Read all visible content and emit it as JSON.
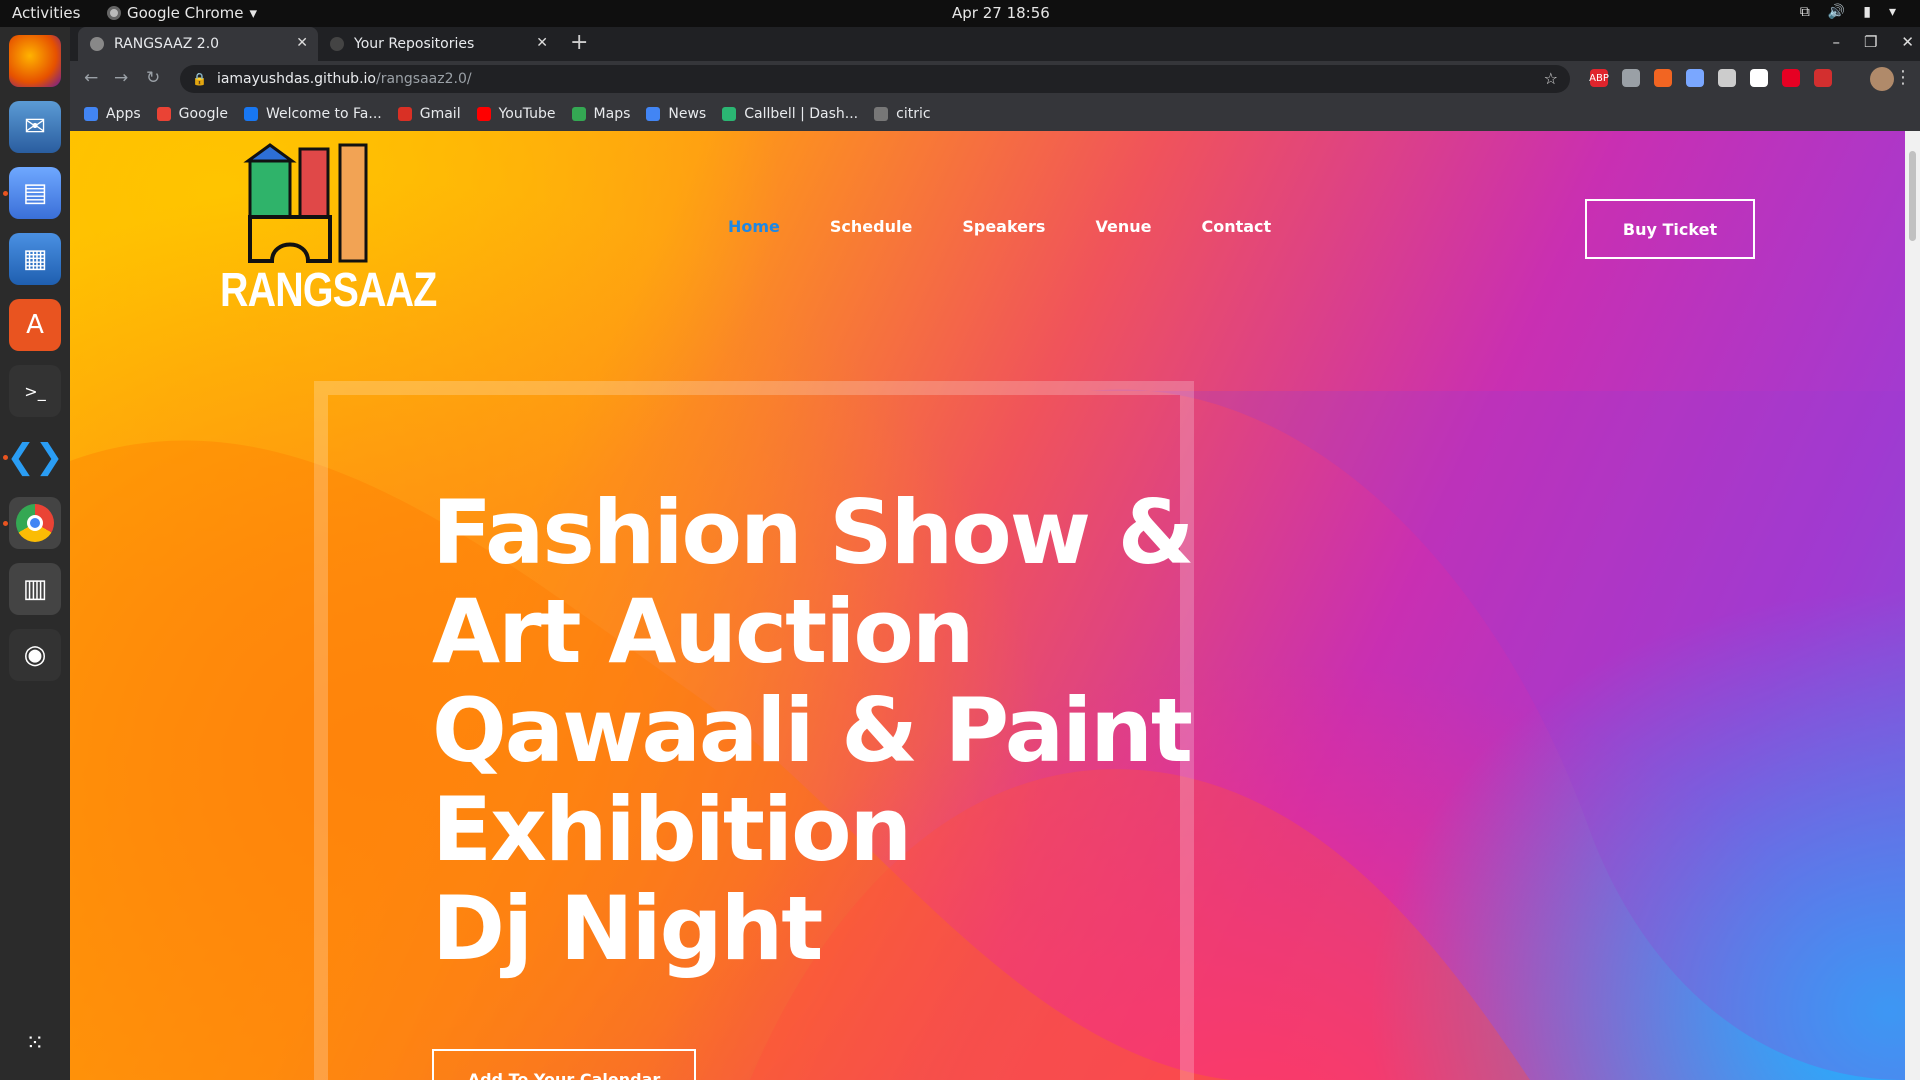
{
  "os": {
    "activities": "Activities",
    "app_name": "Google Chrome",
    "clock": "Apr 27  18:56"
  },
  "browser": {
    "tabs": [
      {
        "title": "RANGSAAZ 2.0",
        "active": true
      },
      {
        "title": "Your Repositories",
        "active": false
      }
    ],
    "url_host": "iamayushdas.github.io",
    "url_path": "/rangsaaz2.0/",
    "bookmarks": [
      {
        "label": "Apps",
        "icon": "apps-grid-icon",
        "color": "#4285f4"
      },
      {
        "label": "Google",
        "icon": "google-icon",
        "color": "#ea4335"
      },
      {
        "label": "Welcome to Fa...",
        "icon": "facebook-icon",
        "color": "#1877f2"
      },
      {
        "label": "Gmail",
        "icon": "gmail-icon",
        "color": "#d93025"
      },
      {
        "label": "YouTube",
        "icon": "youtube-icon",
        "color": "#ff0000"
      },
      {
        "label": "Maps",
        "icon": "maps-icon",
        "color": "#34a853"
      },
      {
        "label": "News",
        "icon": "news-icon",
        "color": "#4285f4"
      },
      {
        "label": "Callbell | Dash...",
        "icon": "callbell-icon",
        "color": "#2bb673"
      },
      {
        "label": "citric",
        "icon": "citric-icon",
        "color": "#777777"
      }
    ],
    "extensions": [
      {
        "label": "ABP",
        "color": "#e0242c"
      },
      {
        "label": "",
        "color": "#9aa0a6"
      },
      {
        "label": "",
        "color": "#f26522"
      },
      {
        "label": "",
        "color": "#7aa7ff"
      },
      {
        "label": "",
        "color": "#cccccc"
      },
      {
        "label": "",
        "color": "#ffffff"
      },
      {
        "label": "",
        "color": "#e60023"
      },
      {
        "label": "",
        "color": "#d32f2f"
      }
    ]
  },
  "page": {
    "logo_text": "RANGSAAZ",
    "nav": [
      {
        "label": "Home",
        "active": true
      },
      {
        "label": "Schedule",
        "active": false
      },
      {
        "label": "Speakers",
        "active": false
      },
      {
        "label": "Venue",
        "active": false
      },
      {
        "label": "Contact",
        "active": false
      }
    ],
    "buy_ticket": "Buy Ticket",
    "hero_lines": [
      "Fashion Show &",
      "Art Auction",
      "Qawaali & Paint",
      "Exhibition",
      "Dj Night"
    ],
    "cta": "Add To Your Calendar",
    "colors": {
      "accent_nav": "#1e88e5",
      "gradient_start": "#ffc000",
      "gradient_mid": "#f0535b",
      "gradient_end": "#7b5ae0",
      "corner_blue": "#1fb6ff"
    }
  }
}
